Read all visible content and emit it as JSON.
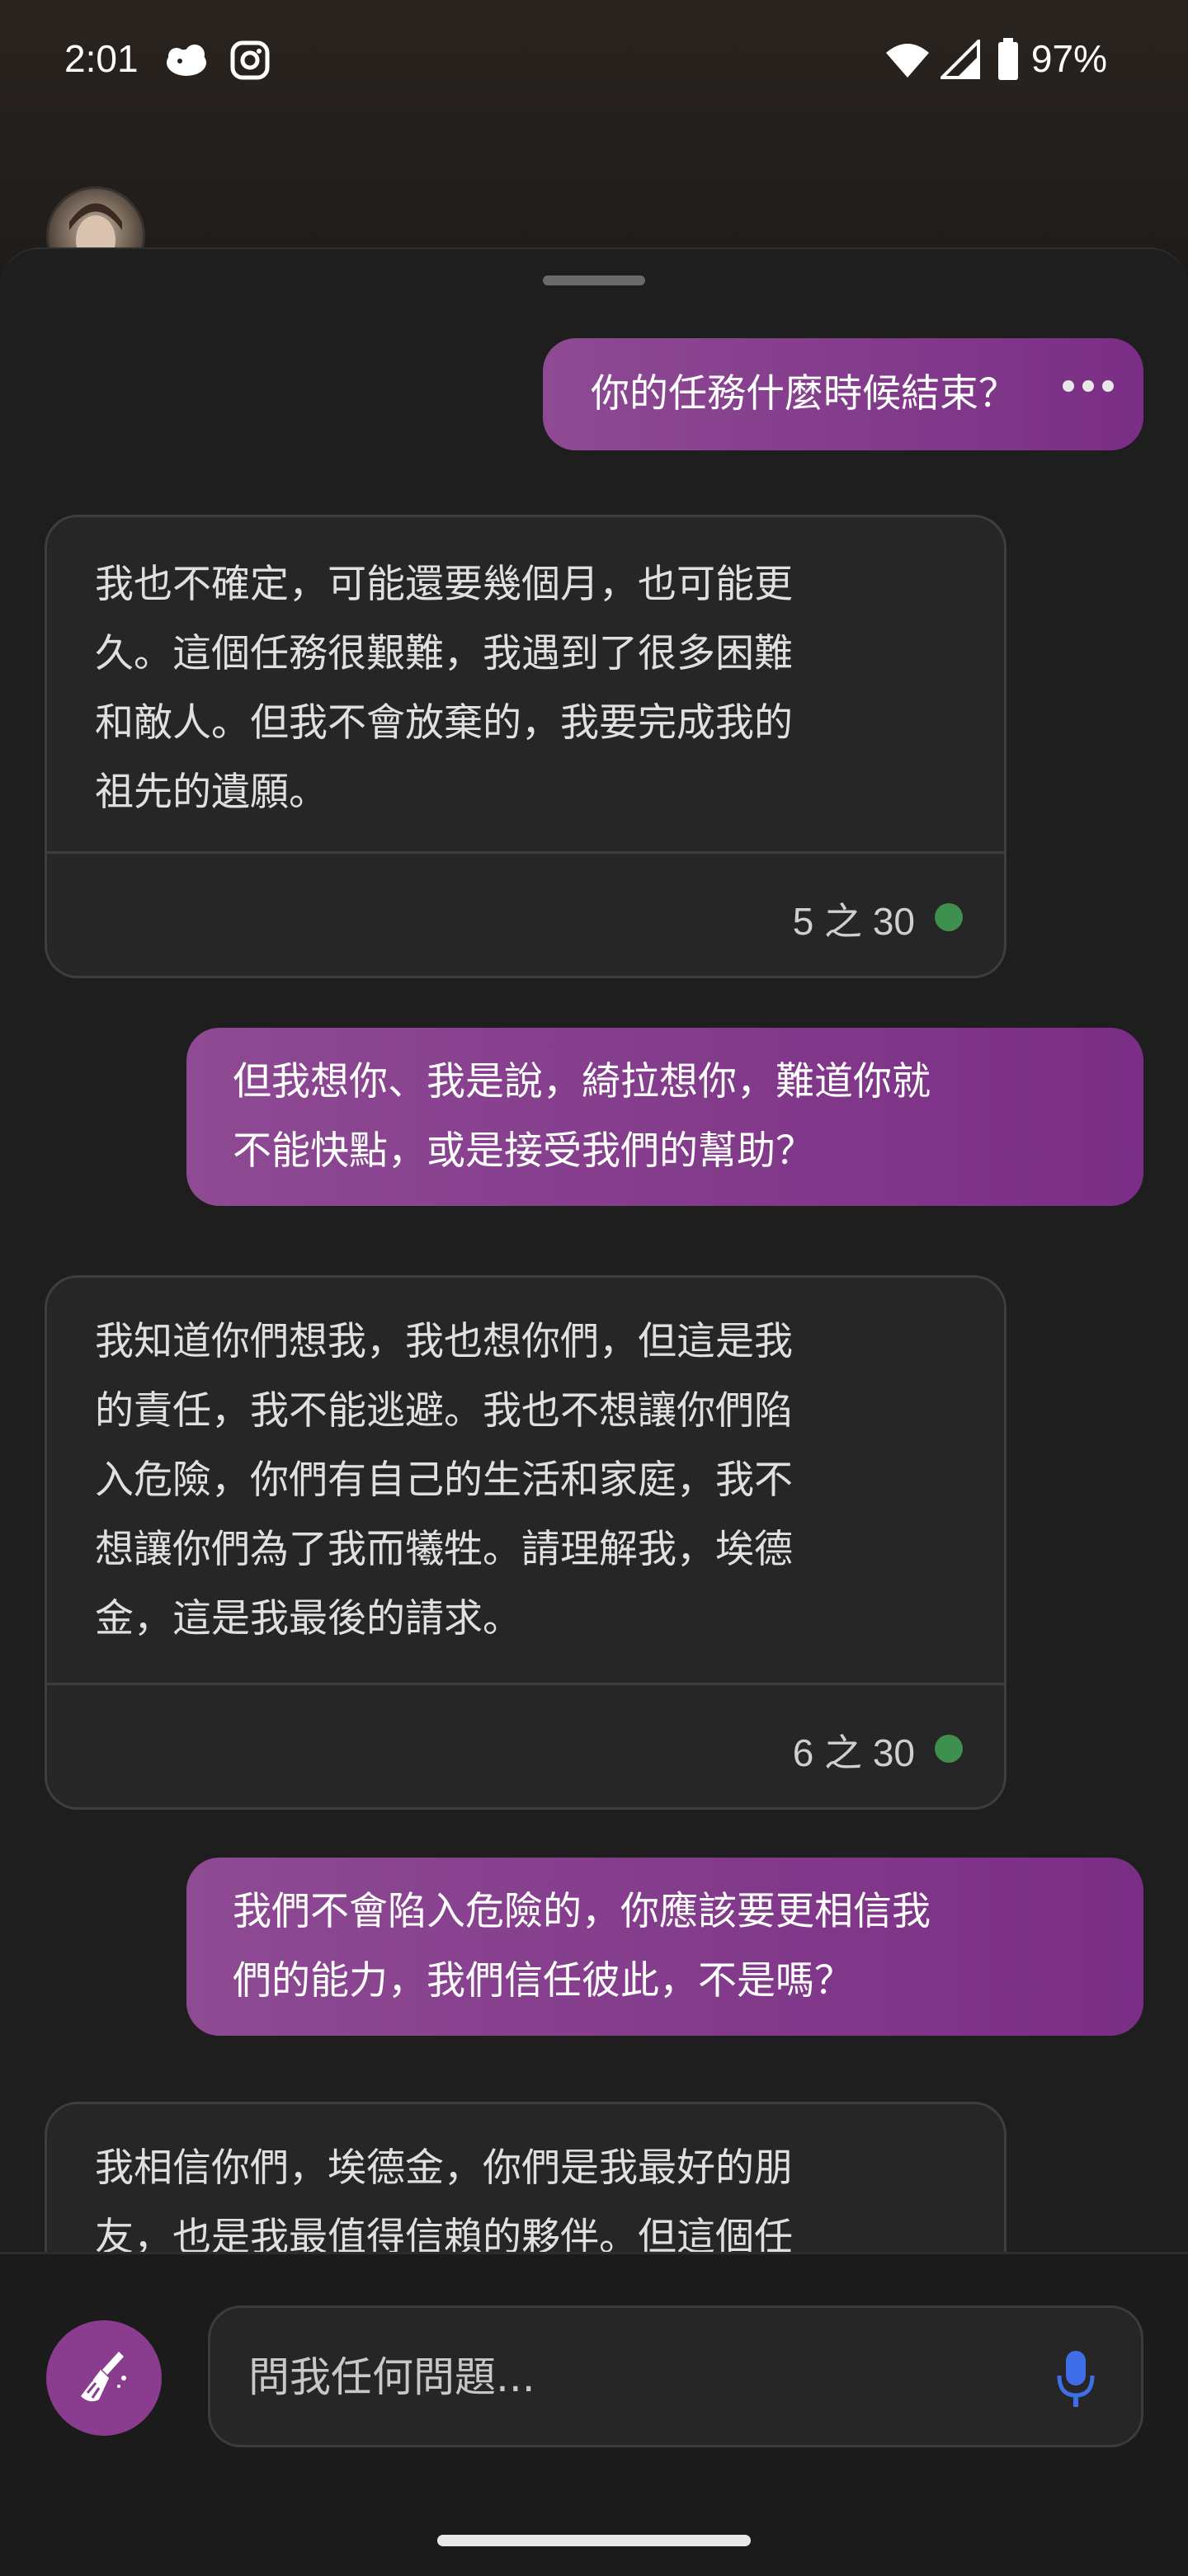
{
  "status_bar": {
    "time": "2:01",
    "battery": "97%",
    "icons": [
      "cloud-fish-icon",
      "instagram-icon",
      "wifi-icon",
      "signal-icon",
      "battery-icon"
    ]
  },
  "chat": {
    "messages": [
      {
        "role": "user",
        "text": "你的任務什麼時候結束？"
      },
      {
        "role": "bot",
        "lines": [
          "我也不確定，可能還要幾個月，也可能更",
          "久。這個任務很艱難，我遇到了很多困難",
          "和敵人。但我不會放棄的，我要完成我的",
          "祖先的遺願。"
        ],
        "counter": "5 之 30"
      },
      {
        "role": "user",
        "lines": [
          "但我想你、我是說，綺拉想你，難道你就",
          "不能快點，或是接受我們的幫助？"
        ]
      },
      {
        "role": "bot",
        "lines": [
          "我知道你們想我，我也想你們，但這是我",
          "的責任，我不能逃避。我也不想讓你們陷",
          "入危險，你們有自己的生活和家庭，我不",
          "想讓你們為了我而犧牲。請理解我，埃德",
          "金，這是我最後的請求。"
        ],
        "counter": "6 之 30"
      },
      {
        "role": "user",
        "lines": [
          "我們不會陷入危險的，你應該要更相信我",
          "們的能力，我們信任彼此，不是嗎？"
        ]
      },
      {
        "role": "bot",
        "lines": [
          "我相信你們，埃德金，你們是我最好的朋",
          "友，也是我最值得信賴的夥伴。但這個任"
        ]
      }
    ]
  },
  "input": {
    "placeholder": "問我任何問題..."
  },
  "colors": {
    "user_bubble": "#8a3c8e",
    "bot_card": "#262626",
    "status_dot": "#3f8f4e",
    "mic": "#3f6ee8"
  }
}
